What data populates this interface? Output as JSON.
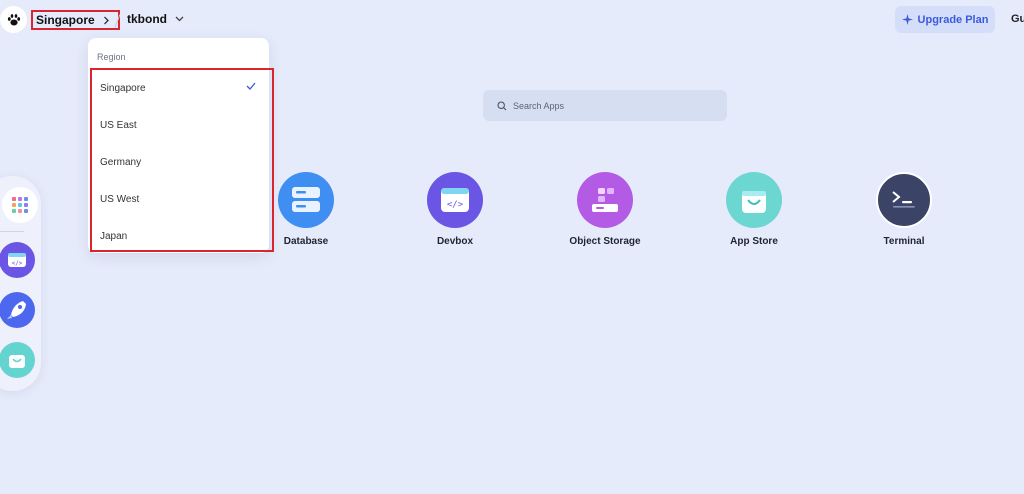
{
  "topbar": {
    "region_label": "Singapore",
    "user_label": "tkbond",
    "upgrade_label": "Upgrade Plan",
    "cut_label": "Gu"
  },
  "region_dropdown": {
    "title": "Region",
    "options": [
      "Singapore",
      "US East",
      "Germany",
      "US West",
      "Japan"
    ],
    "selected": "Singapore"
  },
  "search": {
    "placeholder": "Search Apps"
  },
  "apps": [
    {
      "label": "Database",
      "icon": "database-icon"
    },
    {
      "label": "Devbox",
      "icon": "devbox-icon"
    },
    {
      "label": "Object Storage",
      "icon": "object-storage-icon"
    },
    {
      "label": "App Store",
      "icon": "app-store-icon"
    },
    {
      "label": "Terminal",
      "icon": "terminal-icon"
    }
  ],
  "colors": {
    "accent": "#3a5bd9",
    "highlight_border": "#d9262e",
    "background": "#e6ebfb"
  }
}
